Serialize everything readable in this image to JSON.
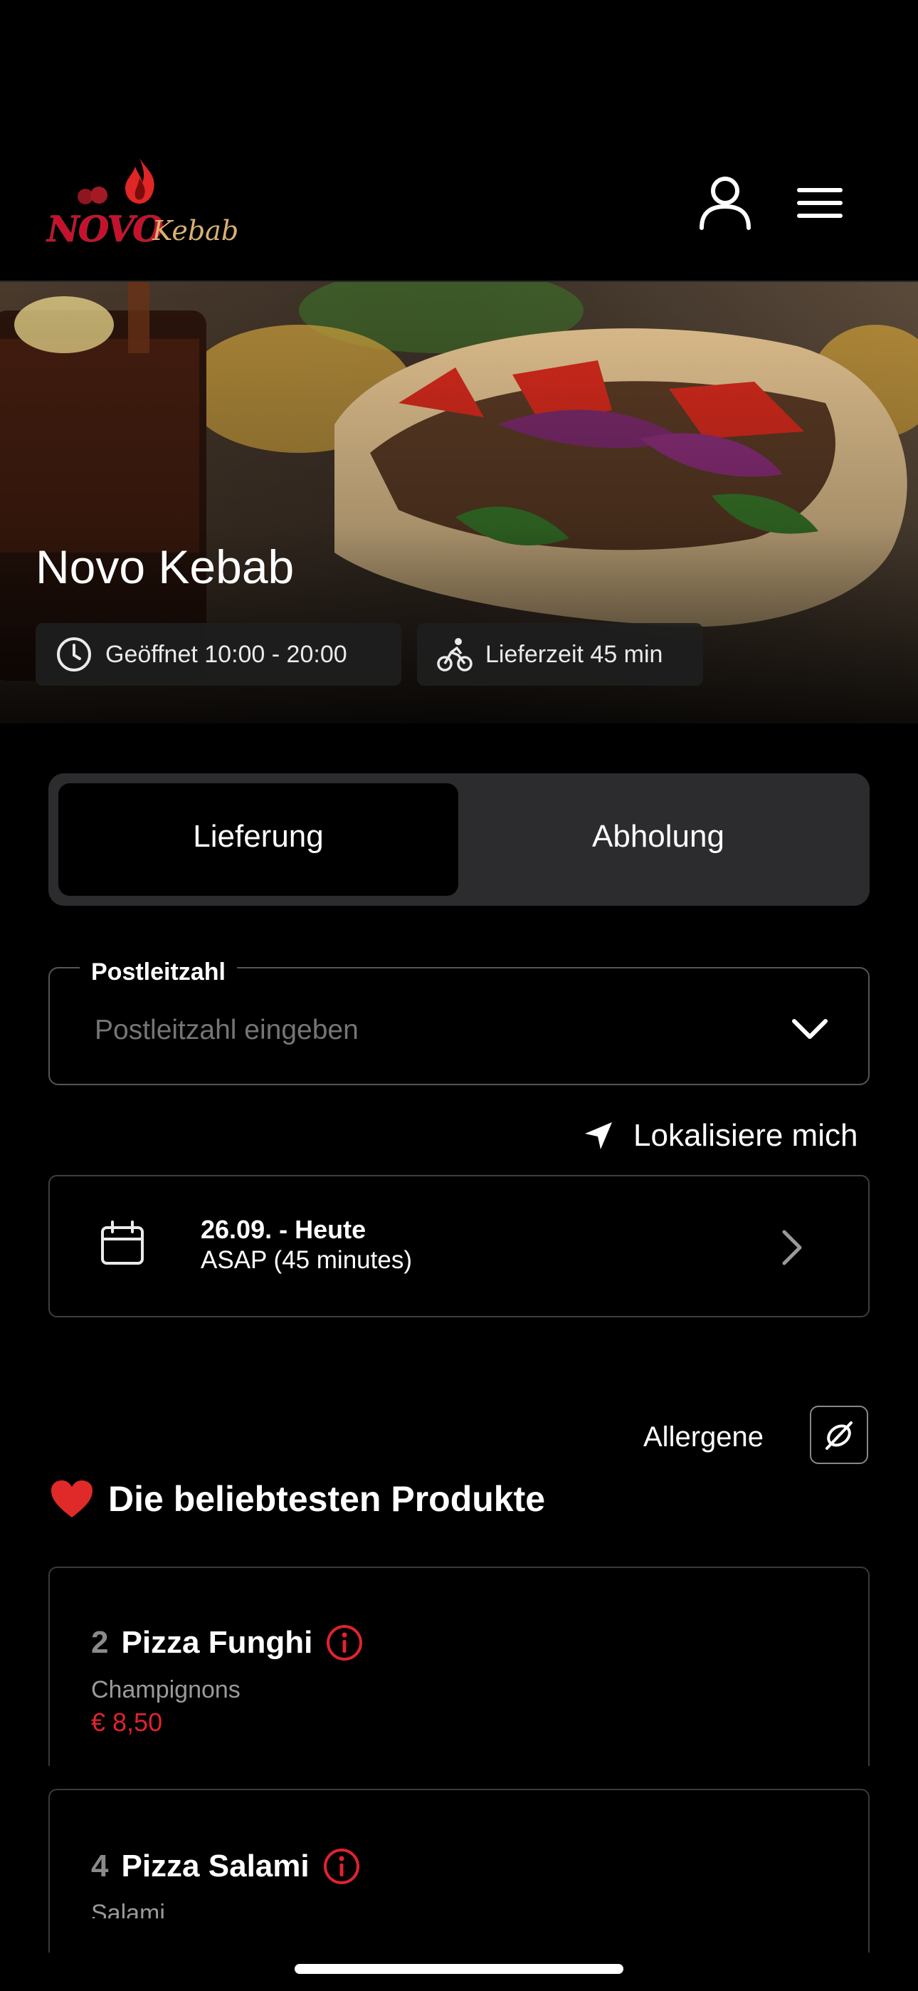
{
  "brand": {
    "logo_word_main": "NOVO",
    "logo_word_script": "Kebab",
    "accent": "#c8102e"
  },
  "hero": {
    "title": "Novo Kebab",
    "opening_chip": "Geöffnet 10:00 - 20:00",
    "delivery_chip": "Lieferzeit 45 min"
  },
  "mode_toggle": {
    "delivery": "Lieferung",
    "pickup": "Abholung",
    "selected": "Lieferung"
  },
  "postcode": {
    "label": "Postleitzahl",
    "placeholder": "Postleitzahl eingeben"
  },
  "locate_label": "Lokalisiere mich",
  "schedule": {
    "date": "26.09. - Heute",
    "time": "ASAP (45 minutes)"
  },
  "allergens_label": "Allergene",
  "popular": {
    "heading": "Die beliebtesten Produkte",
    "items": [
      {
        "number": "2",
        "name": "Pizza Funghi",
        "description": "Champignons",
        "price": "€ 8,50"
      },
      {
        "number": "4",
        "name": "Pizza Salami",
        "description": "Salami",
        "price": ""
      }
    ]
  },
  "colors": {
    "background": "#000000",
    "price": "#e0232e",
    "surface": "#2c2c2e"
  },
  "icons": [
    "user-icon",
    "menu-icon",
    "clock-icon",
    "bike-icon",
    "chevron-down-icon",
    "location-arrow-icon",
    "calendar-icon",
    "chevron-right-icon",
    "allergen-icon",
    "heart-icon",
    "info-icon"
  ]
}
